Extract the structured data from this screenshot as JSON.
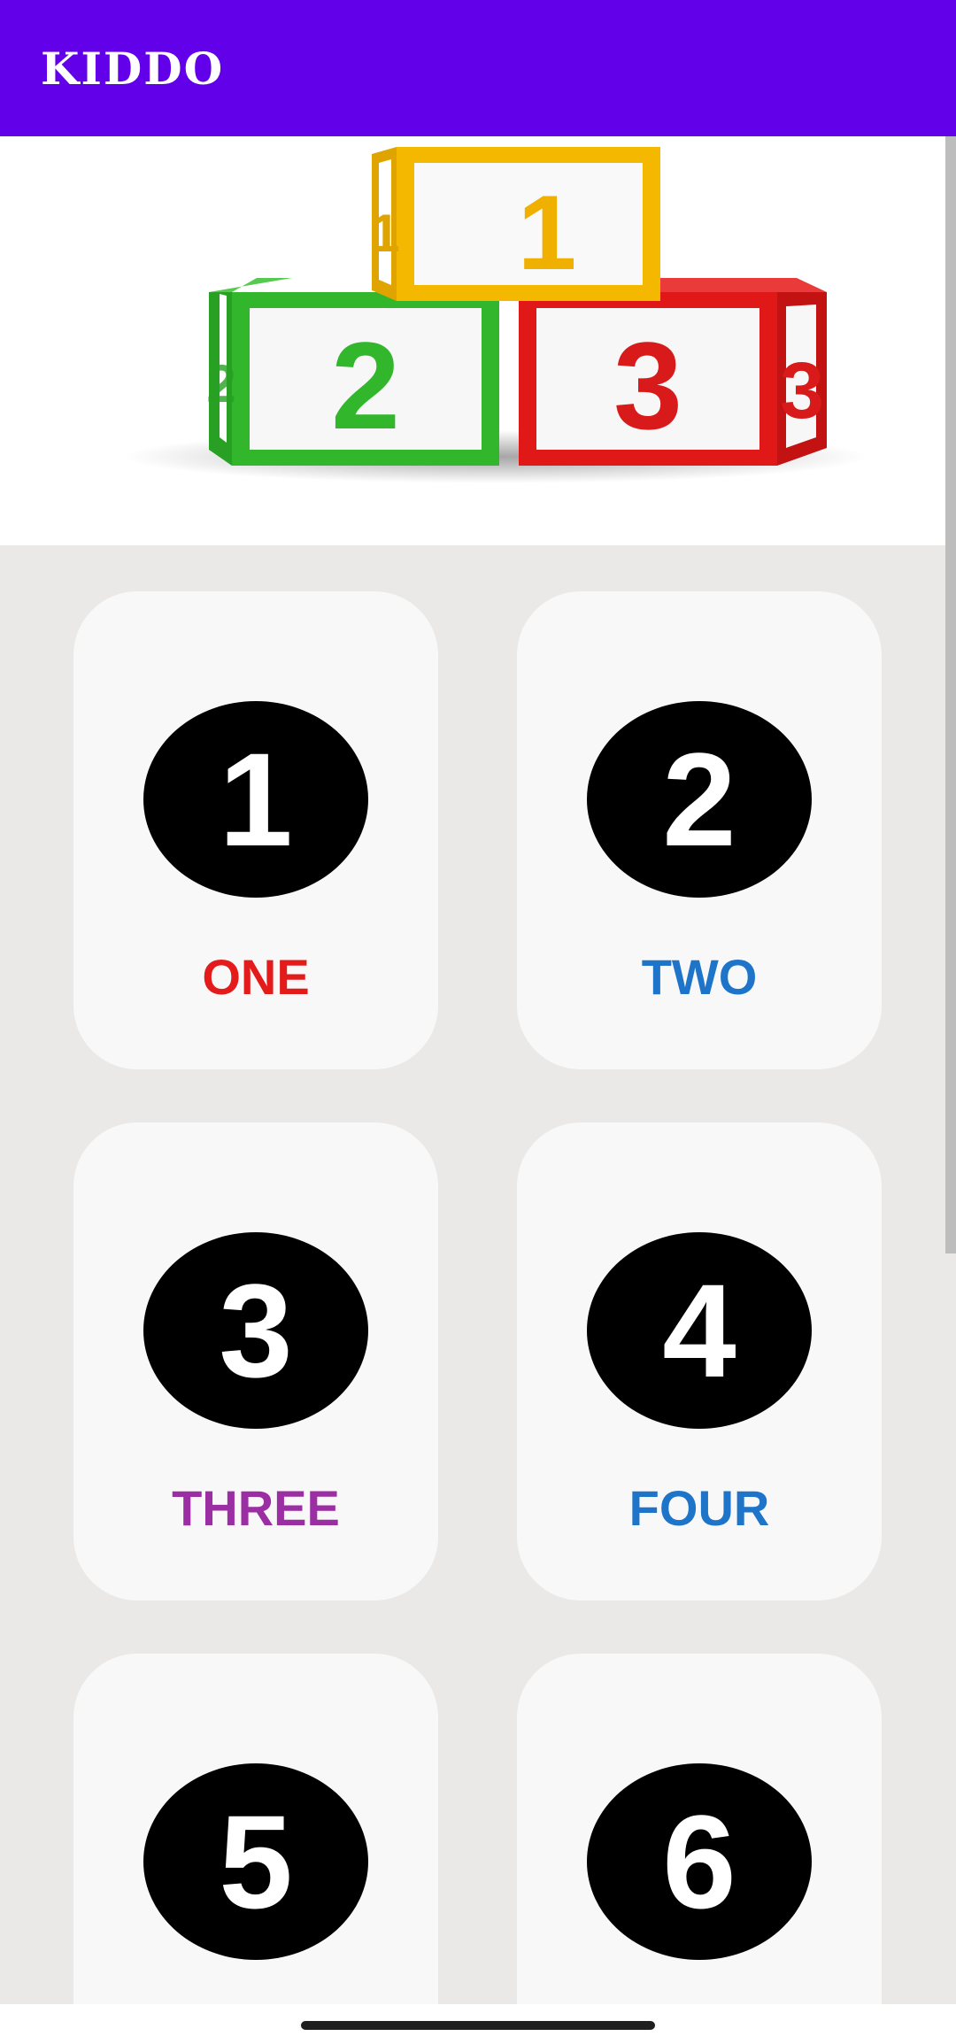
{
  "app_bar": {
    "title": "KIDDO",
    "color": "#6200ea"
  },
  "banner": {
    "blocks": [
      {
        "digit": "1",
        "color": "#f5b800"
      },
      {
        "digit": "2",
        "color": "#2fb52a"
      },
      {
        "digit": "3",
        "color": "#e01818"
      }
    ]
  },
  "numbers": [
    {
      "digit": "1",
      "word": "ONE",
      "color": "#e31b1b"
    },
    {
      "digit": "2",
      "word": "TWO",
      "color": "#1e74c9"
    },
    {
      "digit": "3",
      "word": "THREE",
      "color": "#9c2ea4"
    },
    {
      "digit": "4",
      "word": "FOUR",
      "color": "#1e74c9"
    },
    {
      "digit": "5",
      "word": "",
      "color": ""
    },
    {
      "digit": "6",
      "word": "",
      "color": ""
    }
  ]
}
